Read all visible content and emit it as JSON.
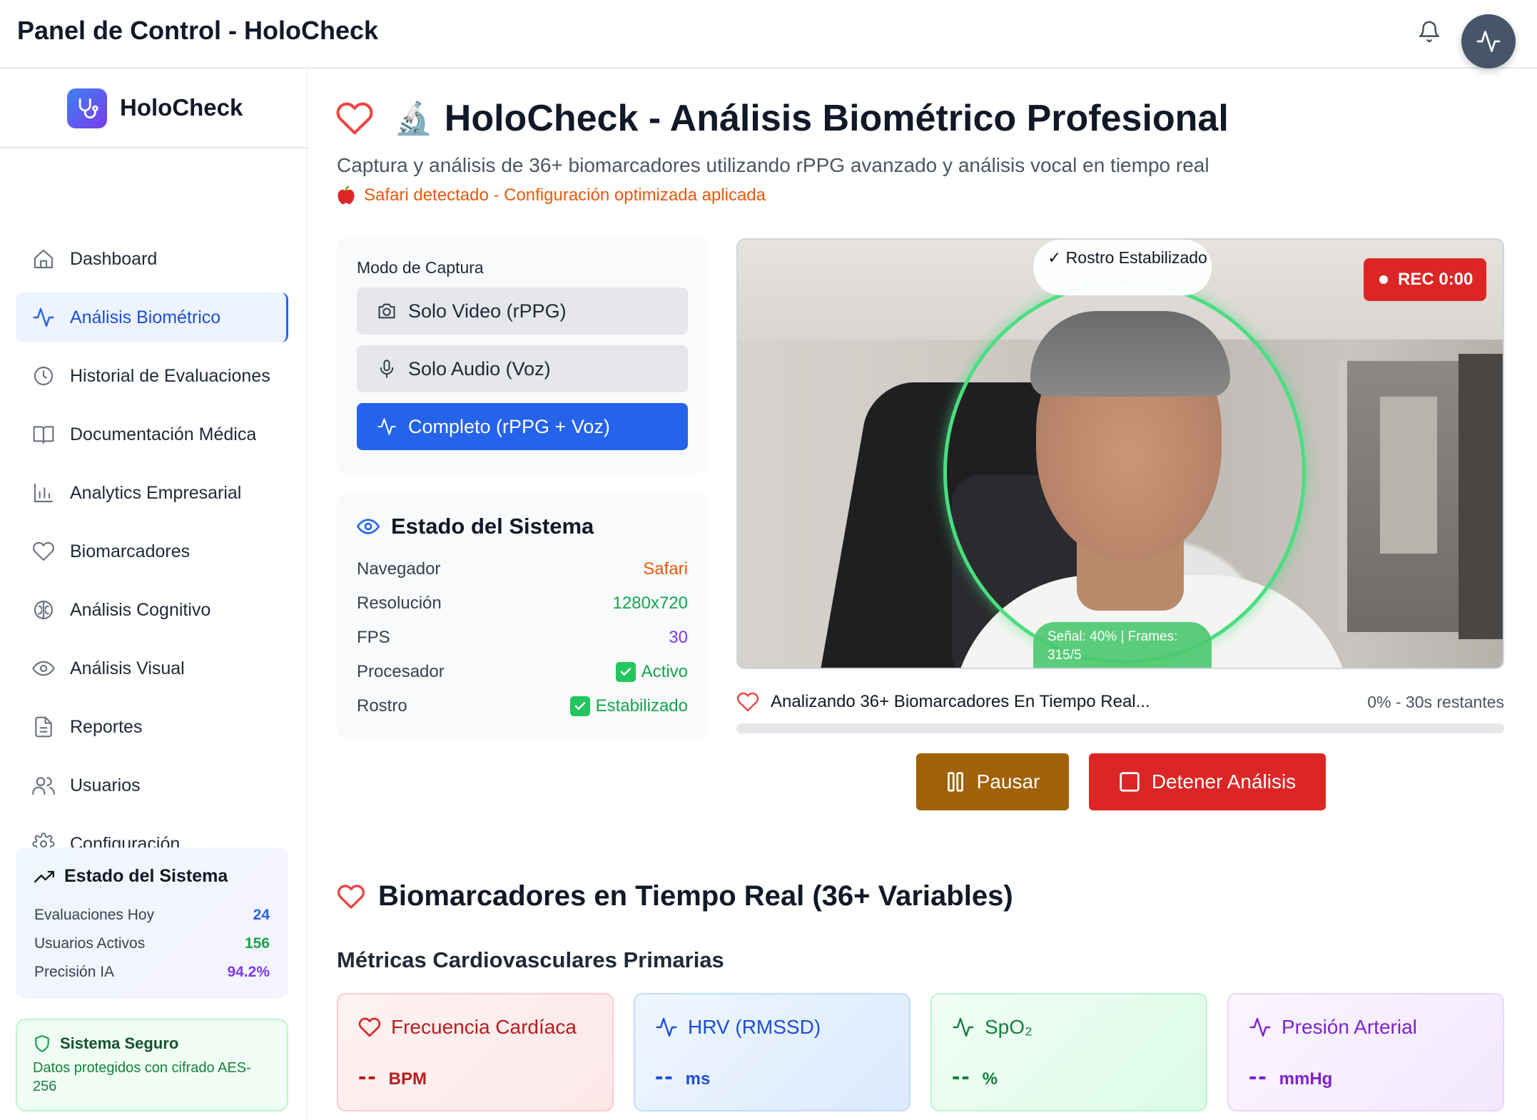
{
  "header": {
    "title": "Panel de Control - HoloCheck"
  },
  "brand": {
    "name": "HoloCheck"
  },
  "sidebar": {
    "items": [
      {
        "label": "Dashboard",
        "icon": "home-icon"
      },
      {
        "label": "Análisis Biométrico",
        "icon": "activity-icon",
        "active": true
      },
      {
        "label": "Historial de Evaluaciones",
        "icon": "clock-icon"
      },
      {
        "label": "Documentación Médica",
        "icon": "book-icon"
      },
      {
        "label": "Analytics Empresarial",
        "icon": "bar-chart-icon"
      },
      {
        "label": "Biomarcadores",
        "icon": "heart-icon"
      },
      {
        "label": "Análisis Cognitivo",
        "icon": "brain-icon"
      },
      {
        "label": "Análisis Visual",
        "icon": "eye-icon"
      },
      {
        "label": "Reportes",
        "icon": "file-text-icon"
      },
      {
        "label": "Usuarios",
        "icon": "users-icon"
      },
      {
        "label": "Configuración",
        "icon": "gear-icon"
      }
    ],
    "system": {
      "title": "Estado del Sistema",
      "rows": [
        {
          "label": "Evaluaciones Hoy",
          "value": "24",
          "color": "#2563eb"
        },
        {
          "label": "Usuarios Activos",
          "value": "156",
          "color": "#16a34a"
        },
        {
          "label": "Precisión IA",
          "value": "94.2%",
          "color": "#7c3aed"
        }
      ]
    },
    "security": {
      "title": "Sistema Seguro",
      "text": "Datos protegidos con cifrado AES-256"
    }
  },
  "main": {
    "title": "HoloCheck - Análisis Biométrico Profesional",
    "title_emoji": "🔬",
    "subtitle": "Captura y análisis de 36+ biomarcadores utilizando rPPG avanzado y análisis vocal en tiempo real",
    "browser_notice": "Safari detectado - Configuración optimizada aplicada",
    "capture_mode": {
      "title": "Modo de Captura",
      "options": [
        {
          "label": "Solo Video (rPPG)",
          "icon": "camera-icon",
          "selected": false
        },
        {
          "label": "Solo Audio (Voz)",
          "icon": "mic-icon",
          "selected": false
        },
        {
          "label": "Completo (rPPG + Voz)",
          "icon": "activity-icon",
          "selected": true
        }
      ]
    },
    "system_state": {
      "title": "Estado del Sistema",
      "rows": [
        {
          "label": "Navegador",
          "value": "Safari",
          "color": "#ea580c",
          "check": false
        },
        {
          "label": "Resolución",
          "value": "1280x720",
          "color": "#16a34a",
          "check": false
        },
        {
          "label": "FPS",
          "value": "30",
          "color": "#7c3aed",
          "check": false
        },
        {
          "label": "Procesador",
          "value": "Activo",
          "color": "#16a34a",
          "check": true
        },
        {
          "label": "Rostro",
          "value": "Estabilizado",
          "color": "#16a34a",
          "check": true
        }
      ]
    },
    "video": {
      "face_badge": "✓ Rostro Estabilizado",
      "rec_label": "REC 0:00",
      "signal_text": "Señal: 40% | Frames: 315/5"
    },
    "progress": {
      "label": "Analizando 36+ Biomarcadores En Tiempo Real...",
      "status": "0% - 30s restantes",
      "percent": 0
    },
    "buttons": {
      "pause": "Pausar",
      "stop": "Detener Análisis"
    },
    "biomarkers": {
      "title": "Biomarcadores en Tiempo Real (36+ Variables)",
      "section": "Métricas Cardiovasculares Primarias",
      "metrics": [
        {
          "label": "Frecuencia Cardíaca",
          "value": "--",
          "unit": "BPM",
          "icon": "heart-icon"
        },
        {
          "label": "HRV (RMSSD)",
          "value": "--",
          "unit": "ms",
          "icon": "activity-icon"
        },
        {
          "label": "SpO₂",
          "value": "--",
          "unit": "%",
          "icon": "activity-icon"
        },
        {
          "label": "Presión Arterial",
          "value": "--",
          "unit": "mmHg",
          "icon": "activity-icon"
        }
      ]
    }
  },
  "colors": {
    "primary": "#2563eb",
    "danger": "#dc2626",
    "warning": "#a16207",
    "success": "#16a34a",
    "accent": "#7c3aed"
  }
}
